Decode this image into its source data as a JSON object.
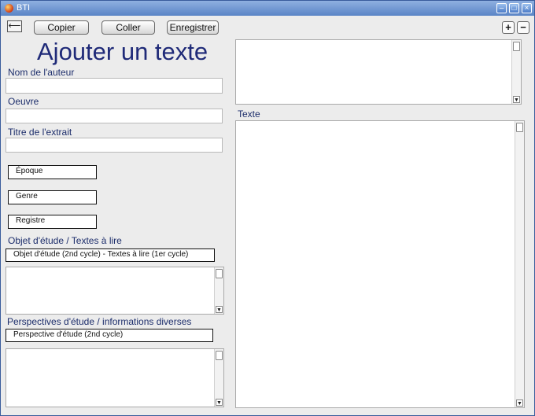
{
  "window": {
    "title": "BTI"
  },
  "toolbar": {
    "back_label": "⟵",
    "copy_label": "Copier",
    "paste_label": "Coller",
    "save_label": "Enregistrer",
    "zoom_in_label": "+",
    "zoom_out_label": "−"
  },
  "form": {
    "heading": "Ajouter un texte",
    "author_label": "Nom de l'auteur",
    "author_value": "",
    "work_label": "Oeuvre",
    "work_value": "",
    "excerpt_title_label": "Titre de l'extrait",
    "excerpt_title_value": "",
    "epoch_select": "Époque",
    "genre_select": "Genre",
    "register_select": "Registre",
    "study_object_label": "Objet d'étude / Textes à lire",
    "study_object_select": "Objet d'étude (2nd cycle) - Textes à lire (1er cycle)",
    "study_object_text": "",
    "perspectives_label": "Perspectives d'étude / informations diverses",
    "perspectives_select": "Perspective d'étude (2nd cycle)",
    "perspectives_text": ""
  },
  "right": {
    "top_text": "",
    "text_label": "Texte",
    "text_value": ""
  }
}
